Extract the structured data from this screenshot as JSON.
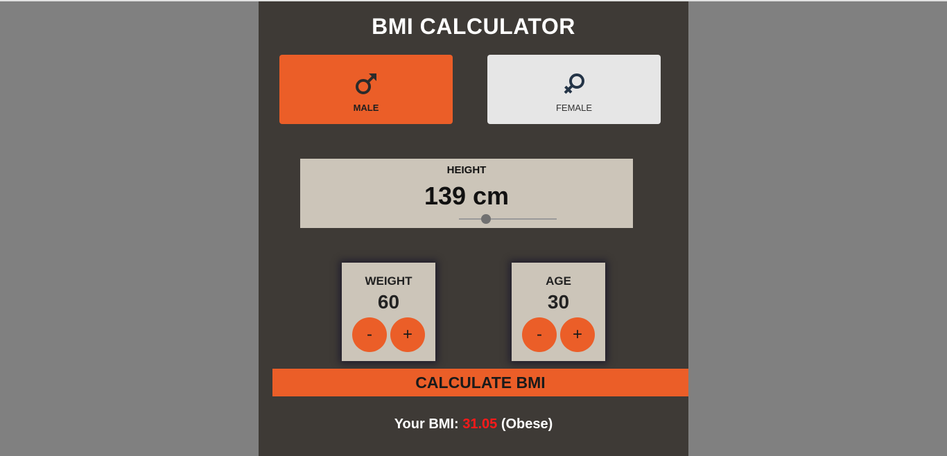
{
  "app": {
    "title": "BMI CALCULATOR",
    "colors": {
      "accent": "#eb5e28",
      "panel": "#3e3a36",
      "card": "#ccc5b9",
      "page_background": "#808080",
      "bmi_value": "#ff1a1a"
    }
  },
  "gender": {
    "options": [
      {
        "label": "MALE",
        "icon": "male-symbol-icon",
        "selected": true
      },
      {
        "label": "FEMALE",
        "icon": "female-symbol-icon",
        "selected": false
      }
    ]
  },
  "height": {
    "label": "HEIGHT",
    "value_text": "139 cm",
    "slider_fraction": 0.28
  },
  "weight": {
    "label": "WEIGHT",
    "value": "60",
    "decrement_label": "-",
    "increment_label": "+"
  },
  "age": {
    "label": "AGE",
    "value": "30",
    "decrement_label": "-",
    "increment_label": "+"
  },
  "calculate_button": {
    "label": "CALCULATE BMI"
  },
  "result": {
    "prefix": "Your BMI:",
    "value": "31.05",
    "category": "(Obese)"
  }
}
